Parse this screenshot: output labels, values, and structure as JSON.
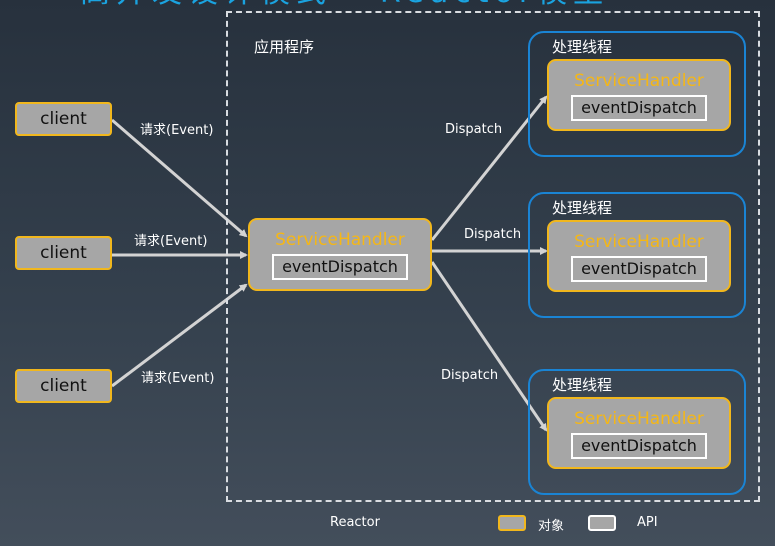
{
  "title": "高并发设计模式 - Reactor模型",
  "app_label": "应用程序",
  "clients": [
    {
      "label": "client"
    },
    {
      "label": "client"
    },
    {
      "label": "client"
    }
  ],
  "request_labels": [
    "请求(Event)",
    "请求(Event)",
    "请求(Event)"
  ],
  "dispatch_labels": [
    "Dispatch",
    "Dispatch",
    "Dispatch"
  ],
  "center_handler": {
    "name": "ServiceHandler",
    "api": "eventDispatch"
  },
  "threads": [
    {
      "label": "处理线程",
      "handler": "ServiceHandler",
      "api": "eventDispatch"
    },
    {
      "label": "处理线程",
      "handler": "ServiceHandler",
      "api": "eventDispatch"
    },
    {
      "label": "处理线程",
      "handler": "ServiceHandler",
      "api": "eventDispatch"
    }
  ],
  "legend": {
    "reactor_label": "Reactor",
    "object_label": "对象",
    "api_label": "API"
  },
  "colors": {
    "object_border": "#f1b71d",
    "handler_text": "#f5b716",
    "thread_border": "#1a84d4",
    "arrow": "#d3d3d3"
  }
}
